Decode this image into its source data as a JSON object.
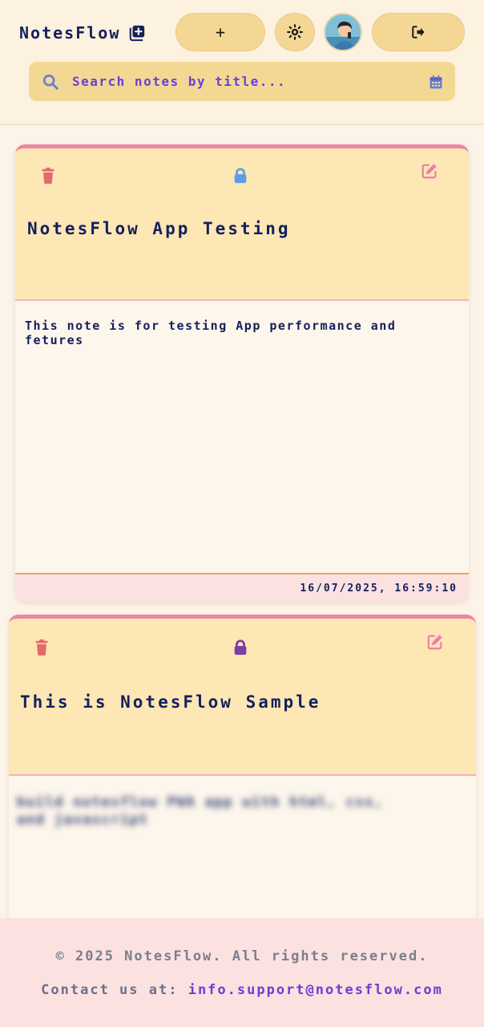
{
  "header": {
    "brand": "NotesFlow",
    "add_label": "+",
    "search_placeholder": "Search notes by title..."
  },
  "notes": [
    {
      "title": "NotesFlow App Testing",
      "body": "This note is for testing App performance and fetures",
      "timestamp": "16/07/2025, 16:59:10",
      "lock_color": "#5b9ee6"
    },
    {
      "title": "This is NotesFlow Sample",
      "body": "build notesflow PWA app with html, css, and javascript",
      "lock_color": "#7b3fa6"
    }
  ],
  "footer": {
    "copyright": "© 2025 NotesFlow. All rights reserved.",
    "contact_prefix": "Contact us at: ",
    "contact_email": "info.support@notesflow.com"
  },
  "colors": {
    "accent": "#6b3fd6",
    "trash": "#e26b6b",
    "edit": "#ee7fa6"
  }
}
